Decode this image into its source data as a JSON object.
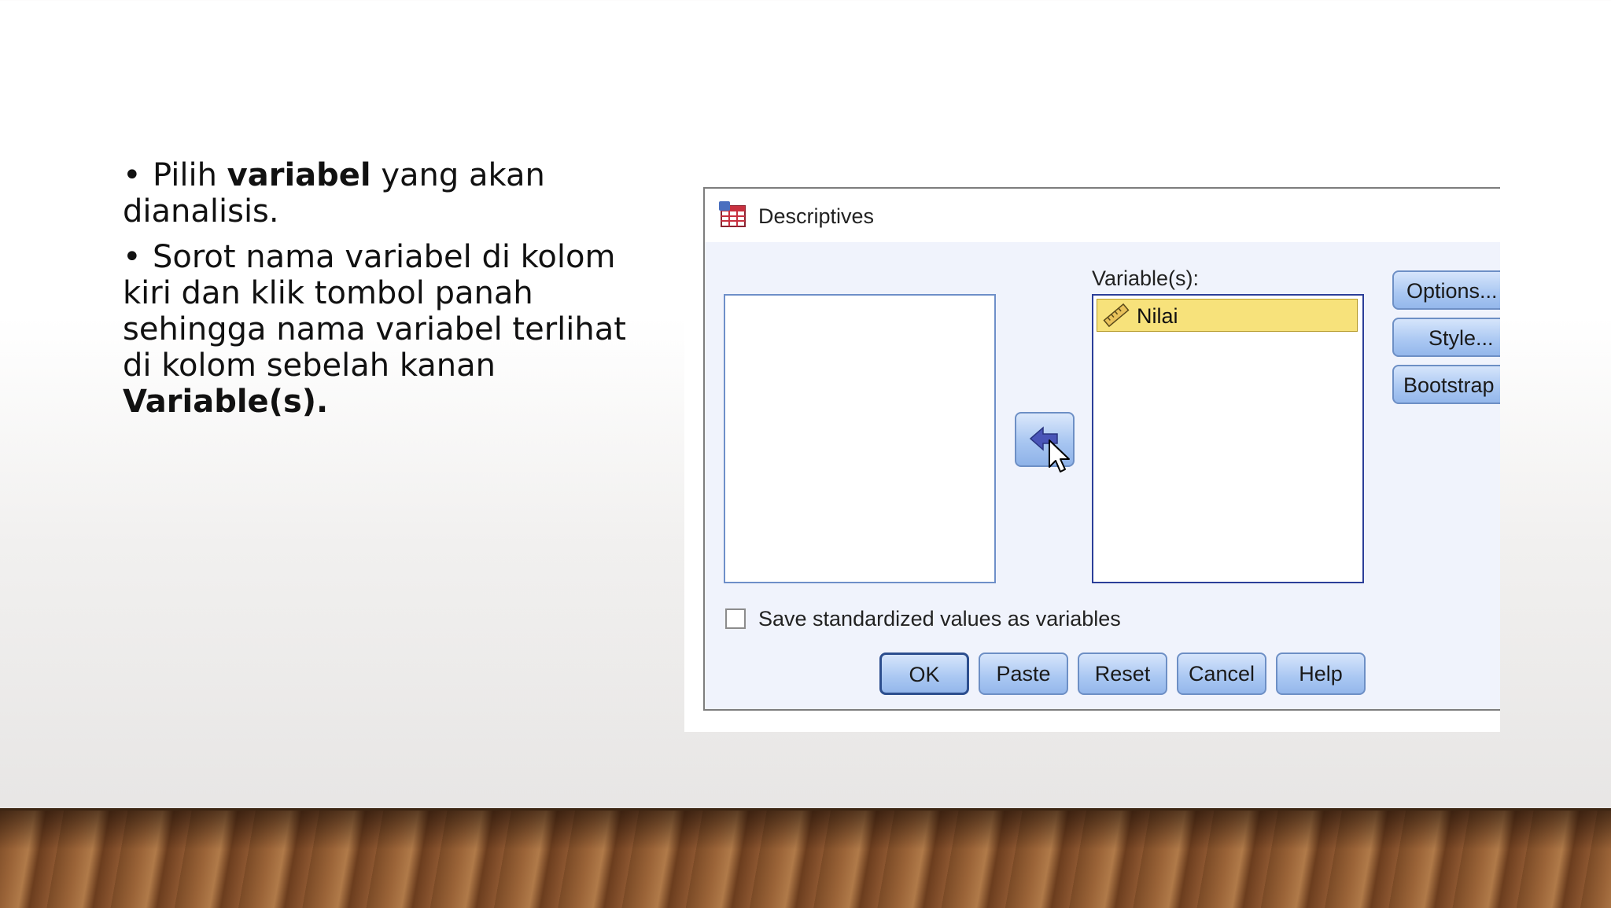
{
  "slide": {
    "bullets": [
      {
        "segments": [
          {
            "text": "Pilih ",
            "bold": false
          },
          {
            "text": "variabel",
            "bold": true
          },
          {
            "text": " yang akan dianalisis.",
            "bold": false
          }
        ]
      },
      {
        "segments": [
          {
            "text": "Sorot nama variabel di kolom kiri dan klik tombol panah sehingga nama variabel terlihat di kolom sebelah kanan ",
            "bold": false
          },
          {
            "text": "Variable(s).",
            "bold": true
          }
        ]
      }
    ],
    "bullet_char": "•"
  },
  "dialog": {
    "title": "Descriptives",
    "app_icon": "spss-table-icon",
    "target_label": "Variable(s):",
    "variables": [
      {
        "name": "Nilai",
        "icon": "ruler-scale-icon",
        "selected": true
      }
    ],
    "move_button_icon": "arrow-left-icon",
    "side_buttons": {
      "options": "Options...",
      "style": "Style...",
      "bootstrap": "Bootstrap"
    },
    "save_checkbox": {
      "label": "Save standardized values as variables",
      "checked": false
    },
    "buttons": {
      "ok": "OK",
      "paste": "Paste",
      "reset": "Reset",
      "cancel": "Cancel",
      "help": "Help"
    }
  },
  "colors": {
    "dialog_bg": "#f0f3fc",
    "selection": "#f7e27b",
    "button_blue": "#a9c7f2"
  }
}
